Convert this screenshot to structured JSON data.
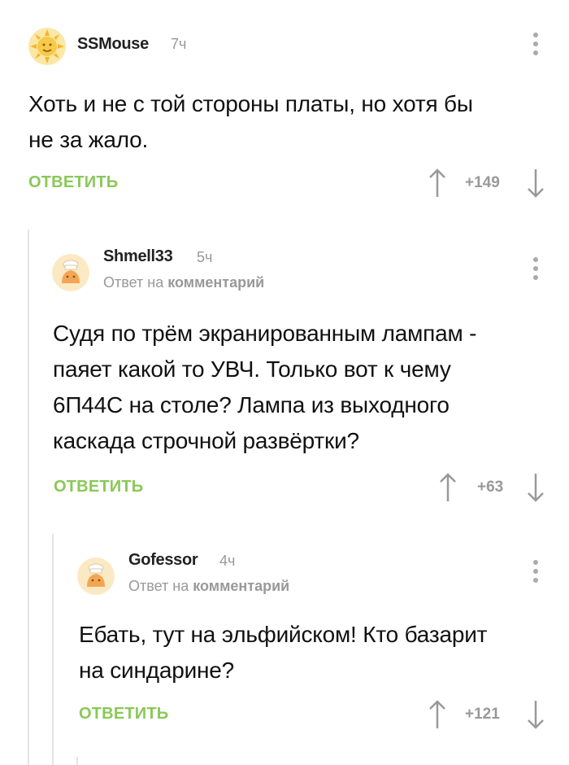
{
  "comments": [
    {
      "username": "SSMouse",
      "time": "7ч",
      "body_lines": [
        "Хоть и не с той стороны платы, но хотя бы",
        "не за жало."
      ],
      "reply_label": "ОТВЕТИТЬ",
      "rating": "+149",
      "avatar_icon": "sun-avatar-icon"
    },
    {
      "username": "Shmell33",
      "time": "5ч",
      "reply_prefix": "Ответ на",
      "reply_target": "комментарий",
      "body_lines": [
        "Судя по трём экранированным лампам -",
        "паяет какой то УВЧ. Только вот к чему",
        "6П44С на столе? Лампа из выходного",
        "каскада строчной развёртки?"
      ],
      "reply_label": "ОТВЕТИТЬ",
      "rating": "+63",
      "avatar_icon": "default-avatar-icon"
    },
    {
      "username": "Gofessor",
      "time": "4ч",
      "reply_prefix": "Ответ на",
      "reply_target": "комментарий",
      "body_lines": [
        "Ебать, тут на эльфийском! Кто базарит",
        "на синдарине?"
      ],
      "reply_label": "ОТВЕТИТЬ",
      "rating": "+121",
      "avatar_icon": "default-avatar-icon"
    }
  ],
  "colors": {
    "reply_green": "#8ac858",
    "muted_gray": "#999999",
    "thread_line": "#e4e4e4"
  }
}
